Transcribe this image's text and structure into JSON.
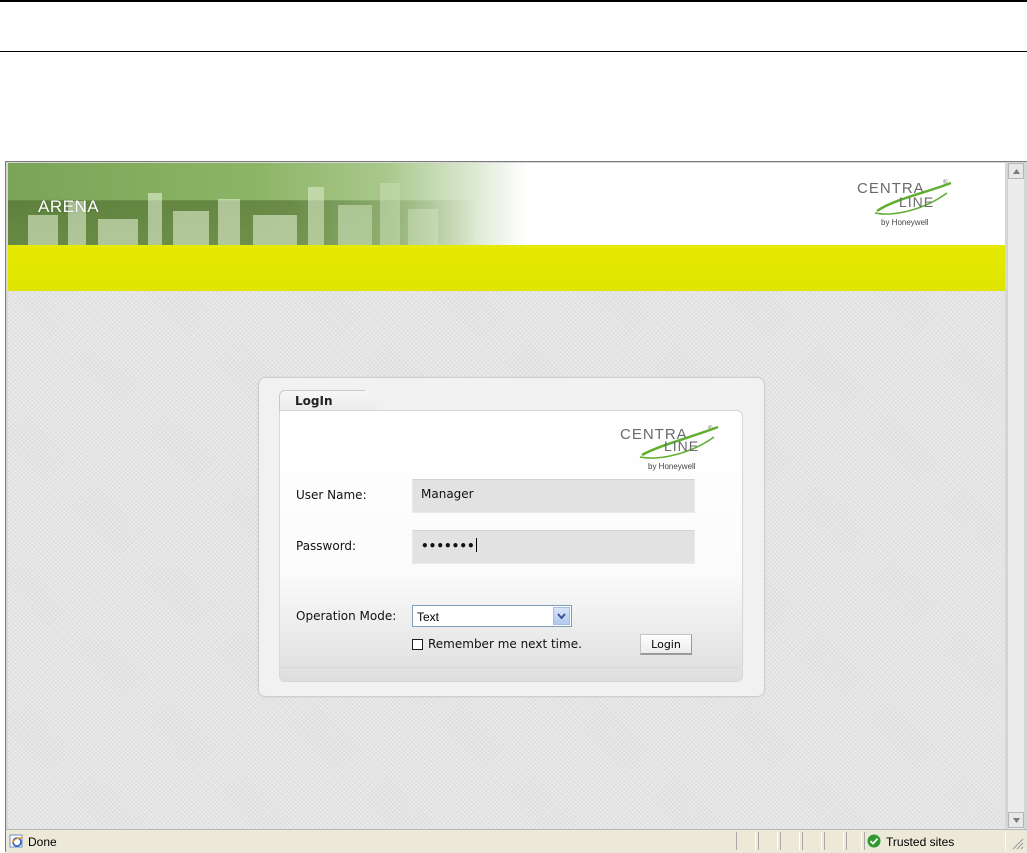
{
  "header": {
    "brand_title": "ARENA",
    "logo_text_top": "CENTRA",
    "logo_text_bottom": "LINE",
    "logo_byline": "by Honeywell",
    "logo_reg": "®"
  },
  "colors": {
    "accent_bar": "#e2e600",
    "header_green": "#8db566",
    "logo_green": "#5fae2e"
  },
  "login": {
    "tab_label": "LogIn",
    "username_label": "User Name:",
    "username_value": "Manager",
    "password_label": "Password:",
    "password_masked": "•••••••",
    "mode_label": "Operation Mode:",
    "mode_selected": "Text",
    "remember_label": "Remember me next time.",
    "remember_checked": false,
    "login_button": "Login"
  },
  "statusbar": {
    "status_text": "Done",
    "zone_text": "Trusted sites"
  },
  "icons": {
    "page_icon": "ie-page-icon",
    "zone_icon": "check-shield-icon",
    "dropdown_icon": "chevron-down-icon"
  }
}
